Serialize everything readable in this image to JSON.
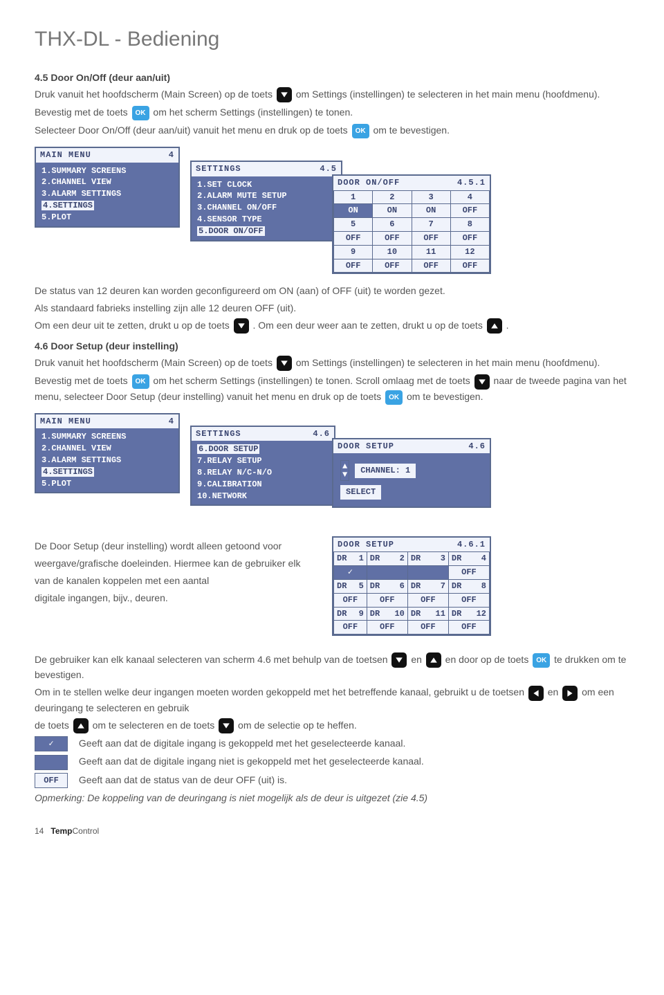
{
  "page_title": "THX-DL - Bediening",
  "s45": {
    "heading": "4.5  Door On/Off (deur aan/uit)",
    "p1a": "Druk vanuit het hoofdscherm (Main Screen) op de toets ",
    "p1b": " om Settings (instellingen) te selecteren in het main menu (hoofdmenu).",
    "p2a": "Bevestig met de toets ",
    "p2b": " om het scherm Settings (instellingen) te tonen.",
    "p3a": "Selecteer Door On/Off (deur aan/uit) vanuit het menu en druk op de toets ",
    "p3b": " om te bevestigen.",
    "status1": "De status van 12 deuren kan worden geconfigureerd om ON (aan) of OFF (uit) te worden gezet.",
    "status2": "Als standaard fabrieks instelling zijn alle 12 deuren OFF (uit).",
    "toggle1a": "Om een deur uit te zetten, drukt u op de toets ",
    "toggle1b": ". Om een deur weer aan te zetten, drukt u op de toets ",
    "toggle1c": "."
  },
  "main_menu": {
    "title": "MAIN MENU",
    "num": "4",
    "items": [
      "1.SUMMARY SCREENS",
      "2.CHANNEL VIEW",
      "3.ALARM SETTINGS",
      "4.SETTINGS",
      "5.PLOT"
    ]
  },
  "settings_45": {
    "title": "SETTINGS",
    "num": "4.5",
    "items": [
      "1.SET CLOCK",
      "2.ALARM MUTE SETUP",
      "3.CHANNEL ON/OFF",
      "4.SENSOR TYPE",
      "5.DOOR ON/OFF"
    ]
  },
  "door_onoff": {
    "title": "DOOR ON/OFF",
    "num": "4.5.1",
    "cells": [
      [
        "1",
        "2",
        "3",
        "4"
      ],
      [
        "ON",
        "ON",
        "ON",
        "OFF"
      ],
      [
        "5",
        "6",
        "7",
        "8"
      ],
      [
        "OFF",
        "OFF",
        "OFF",
        "OFF"
      ],
      [
        "9",
        "10",
        "11",
        "12"
      ],
      [
        "OFF",
        "OFF",
        "OFF",
        "OFF"
      ]
    ]
  },
  "s46": {
    "heading": "4.6  Door Setup (deur instelling)",
    "p1a": "Druk vanuit het hoofdscherm (Main Screen) op de toets ",
    "p1b": " om Settings (instellingen) te selecteren in het main menu (hoofdmenu).",
    "p2a": "Bevestig met de toets ",
    "p2b": " om het scherm Settings (instellingen) te tonen. Scroll omlaag met de toets ",
    "p2c": " naar de tweede pagina van het menu, selecteer Door Setup (deur instelling) vanuit het menu en druk op de toets ",
    "p2d": " om te bevestigen."
  },
  "settings_46": {
    "title": "SETTINGS",
    "num": "4.6",
    "items": [
      "6.DOOR SETUP",
      "7.RELAY SETUP",
      "8.RELAY N/C-N/O",
      "9.CALIBRATION",
      "10.NETWORK"
    ]
  },
  "door_setup_46": {
    "title": "DOOR SETUP",
    "num": "4.6",
    "channel_label": "CHANNEL:",
    "channel_val": "1",
    "select": "SELECT"
  },
  "desc46": {
    "l1": "De Door Setup (deur instelling) wordt alleen getoond voor",
    "l2": "weergave/grafische doeleinden. Hiermee kan de gebruiker elk",
    "l3": "van de kanalen koppelen met een aantal",
    "l4": "digitale ingangen, bijv., deuren."
  },
  "door_setup_461": {
    "title": "DOOR SETUP",
    "num": "4.6.1",
    "rows": [
      [
        {
          "h": "DR",
          "n": "1"
        },
        {
          "h": "DR",
          "n": "2"
        },
        {
          "h": "DR",
          "n": "3"
        },
        {
          "h": "DR",
          "n": "4"
        }
      ],
      [
        "✓",
        "",
        "",
        "OFF"
      ],
      [
        {
          "h": "DR",
          "n": "5"
        },
        {
          "h": "DR",
          "n": "6"
        },
        {
          "h": "DR",
          "n": "7"
        },
        {
          "h": "DR",
          "n": "8"
        }
      ],
      [
        "OFF",
        "OFF",
        "OFF",
        "OFF"
      ],
      [
        {
          "h": "DR",
          "n": "9"
        },
        {
          "h": "DR",
          "n": "10"
        },
        {
          "h": "DR",
          "n": "11"
        },
        {
          "h": "DR",
          "n": "12"
        }
      ],
      [
        "OFF",
        "OFF",
        "OFF",
        "OFF"
      ]
    ]
  },
  "bottom": {
    "p1a": "De gebruiker kan elk kanaal selecteren van scherm 4.6 met behulp van de toetsen ",
    "p1b": " en ",
    "p1c": " en door op de toets ",
    "p1d": " te drukken om te bevestigen.",
    "p2a": "Om in te stellen welke deur ingangen moeten worden gekoppeld met het betreffende kanaal, gebruikt u de toetsen ",
    "p2b": " en ",
    "p2c": " om een deuringang te selecteren en gebruik",
    "p3a": "de toets ",
    "p3b": " om te selecteren en de toets ",
    "p3c": " om de selectie op te heffen.",
    "legend1": "Geeft aan dat de digitale ingang is gekoppeld met het geselecteerde kanaal.",
    "legend2": "Geeft aan dat de digitale ingang niet is gekoppeld met het geselecteerde kanaal.",
    "legend3": "Geeft aan dat de status van de deur OFF (uit) is.",
    "note": "Opmerking: De koppeling van de deuringang is niet mogelijk als de deur is uitgezet (zie 4.5)"
  },
  "ok": "OK",
  "off_label": "OFF",
  "check_label": "✓",
  "footer": {
    "page": "14",
    "brand1": "Temp",
    "brand2": "Control"
  }
}
